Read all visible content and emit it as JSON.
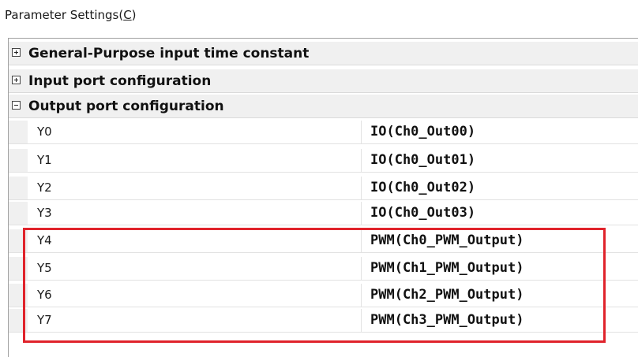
{
  "panel": {
    "title_prefix": "Parameter Settings(",
    "title_mnemonic": "C",
    "title_suffix": ")"
  },
  "categories": [
    {
      "label": "General-Purpose input time constant",
      "expanded": false
    },
    {
      "label": "Input port configuration",
      "expanded": false
    },
    {
      "label": "Output port configuration",
      "expanded": true
    }
  ],
  "output_rows": [
    {
      "name": "Y0",
      "value": "IO(Ch0_Out00)"
    },
    {
      "name": "Y1",
      "value": "IO(Ch0_Out01)"
    },
    {
      "name": "Y2",
      "value": "IO(Ch0_Out02)"
    },
    {
      "name": "Y3",
      "value": "IO(Ch0_Out03)"
    },
    {
      "name": "Y4",
      "value": "PWM(Ch0_PWM_Output)"
    },
    {
      "name": "Y5",
      "value": "PWM(Ch1_PWM_Output)"
    },
    {
      "name": "Y6",
      "value": "PWM(Ch2_PWM_Output)"
    },
    {
      "name": "Y7",
      "value": "PWM(Ch3_PWM_Output)"
    }
  ],
  "colors": {
    "highlight": "#e0232b",
    "category_bg": "#f0f0f0"
  }
}
